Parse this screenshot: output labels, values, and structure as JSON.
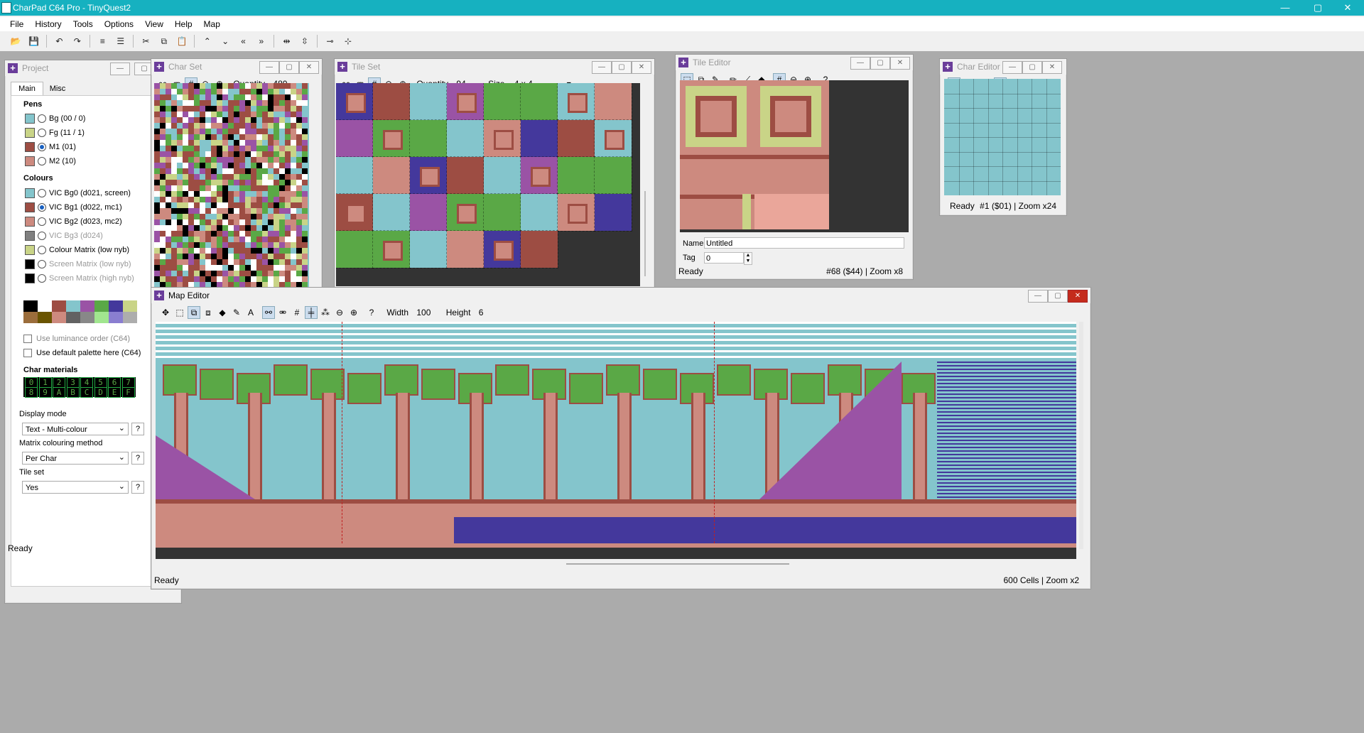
{
  "app": {
    "title": "CharPad C64 Pro - TinyQuest2"
  },
  "window_controls": {
    "minimize": "—",
    "maximize": "▢",
    "close": "✕"
  },
  "menu": [
    "File",
    "History",
    "Tools",
    "Options",
    "View",
    "Help",
    "Map"
  ],
  "project": {
    "title": "Project",
    "tabs": [
      "Main",
      "Misc"
    ],
    "pens_title": "Pens",
    "pens": [
      {
        "label": "Bg (00 / 0)",
        "color": "#84c5cc",
        "selected": false
      },
      {
        "label": "Fg (11 / 1)",
        "color": "#c9d487",
        "selected": false
      },
      {
        "label": "M1 (01)",
        "color": "#9d4d43",
        "selected": true
      },
      {
        "label": "M2 (10)",
        "color": "#cd8a7f",
        "selected": false
      }
    ],
    "colours_title": "Colours",
    "colours": [
      {
        "label": "VIC Bg0 (d021, screen)",
        "color": "#84c5cc",
        "selected": false,
        "disabled": false
      },
      {
        "label": "VIC Bg1 (d022, mc1)",
        "color": "#9d4d43",
        "selected": true,
        "disabled": false
      },
      {
        "label": "VIC Bg2 (d023, mc2)",
        "color": "#cd8a7f",
        "selected": false,
        "disabled": false
      },
      {
        "label": "VIC Bg3 (d024)",
        "color": "#808080",
        "selected": false,
        "disabled": true
      },
      {
        "label": "Colour Matrix (low nyb)",
        "color": "#c9d487",
        "selected": false,
        "disabled": false
      },
      {
        "label": "Screen Matrix (low nyb)",
        "color": "#000000",
        "selected": false,
        "disabled": true
      },
      {
        "label": "Screen Matrix (high nyb)",
        "color": "#000000",
        "selected": false,
        "disabled": true
      }
    ],
    "palette": [
      "#000000",
      "#ffffff",
      "#9d4d43",
      "#84c5cc",
      "#9a53a5",
      "#5aa846",
      "#44389c",
      "#c9d487",
      "#9b6d3b",
      "#6a5400",
      "#cd8a7f",
      "#626262",
      "#888888",
      "#a1e68f",
      "#8a7ed0",
      "#adadad"
    ],
    "check_luminance": "Use luminance order (C64)",
    "check_default_palette": "Use default palette here (C64)",
    "char_materials_title": "Char materials",
    "materials_row1": [
      "0",
      "1",
      "2",
      "3",
      "4",
      "5",
      "6",
      "7"
    ],
    "materials_row2": [
      "8",
      "9",
      "A",
      "B",
      "C",
      "D",
      "E",
      "F"
    ],
    "display_mode_label": "Display mode",
    "display_mode_value": "Text - Multi-colour",
    "matrix_method_label": "Matrix colouring method",
    "matrix_method_value": "Per Char",
    "tile_set_label": "Tile set",
    "tile_set_value": "Yes",
    "help": "?",
    "status": "Ready"
  },
  "charset": {
    "title": "Char Set",
    "quantity_label": "Quantity",
    "quantity": "480"
  },
  "tileset": {
    "title": "Tile Set",
    "quantity_label": "Quantity",
    "quantity": "94",
    "size_label": "Size",
    "size_value": "4 x 4"
  },
  "tile_editor": {
    "title": "Tile Editor",
    "name_label": "Name",
    "name_value": "Untitled",
    "tag_label": "Tag",
    "tag_value": "0",
    "status": "Ready",
    "status_right": "#68 ($44) | Zoom x8"
  },
  "char_editor": {
    "title": "Char Editor",
    "status": "Ready",
    "status_right": "#1 ($01) | Zoom x24"
  },
  "map_editor": {
    "title": "Map Editor",
    "width_label": "Width",
    "width": "100",
    "height_label": "Height",
    "height": "6",
    "status": "Ready",
    "status_right": "600 Cells | Zoom x2"
  },
  "colors": {
    "sky": "#84c5cc",
    "brick": "#9d4d43",
    "pink": "#cd8a7f",
    "green": "#5aa846",
    "purple": "#9a53a5",
    "blue": "#44389c",
    "yellow": "#c9d487",
    "titlebar": "#16b1c0"
  }
}
